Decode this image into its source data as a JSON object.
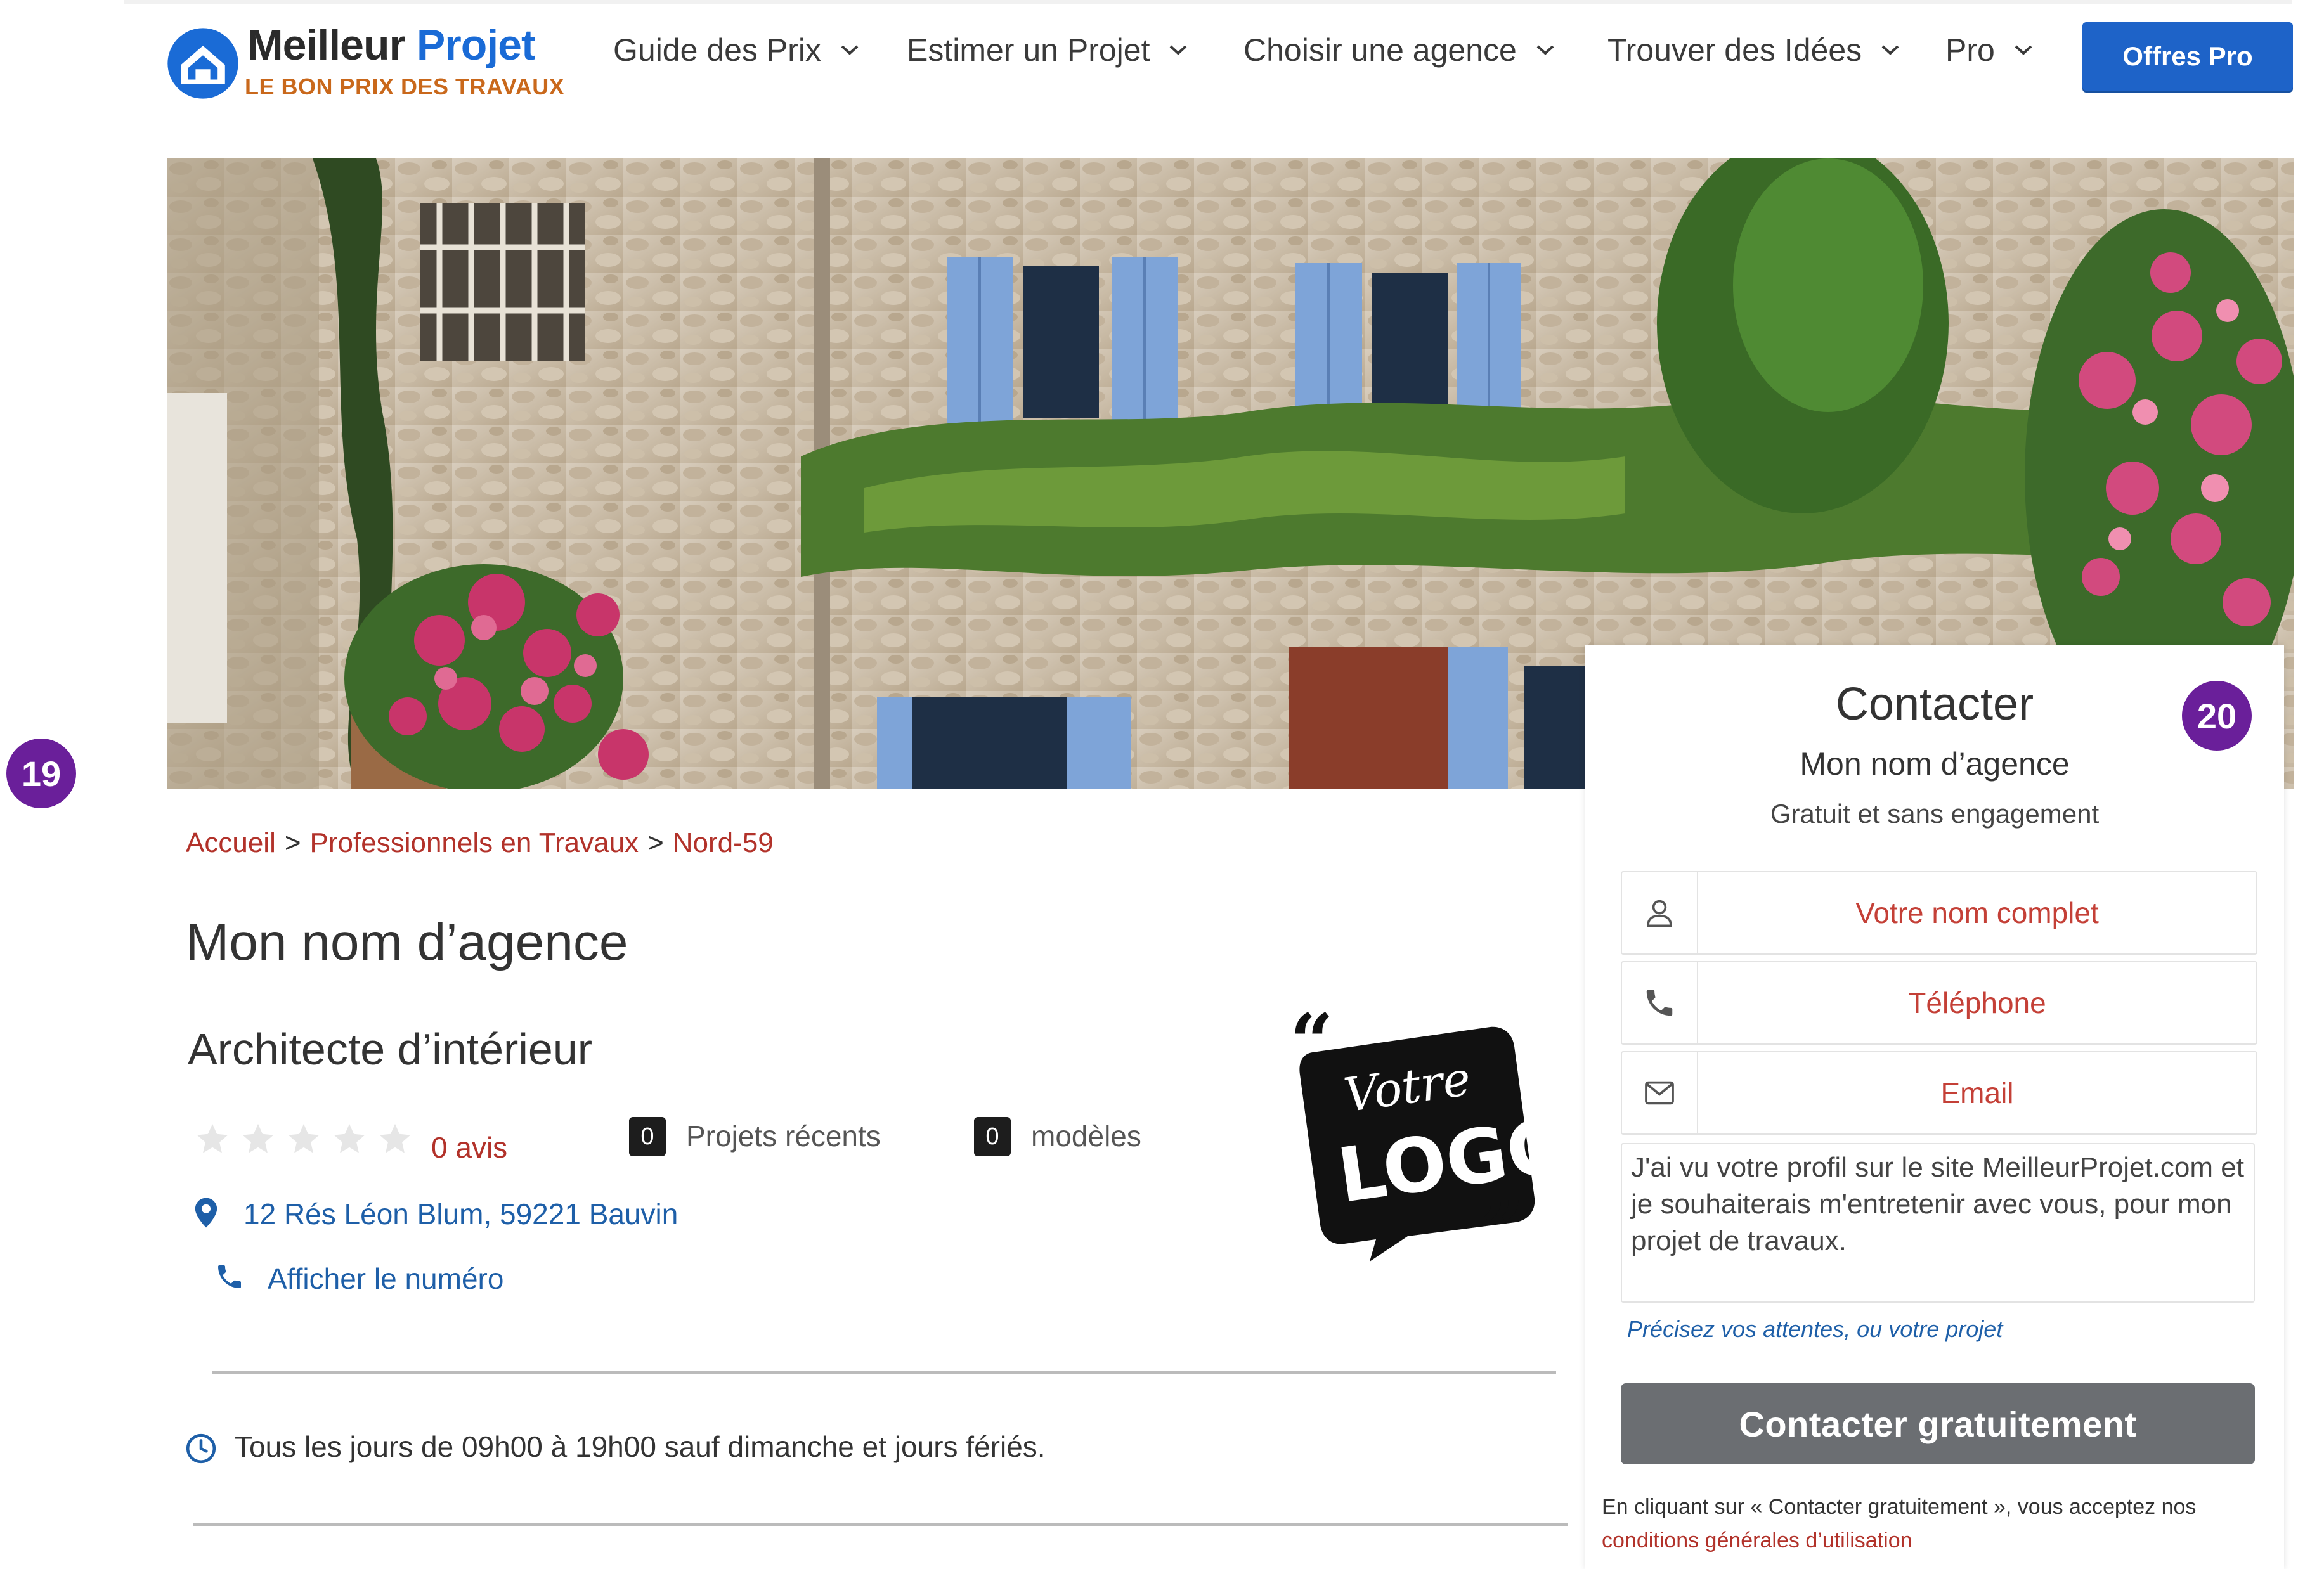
{
  "header": {
    "brand_main": "Meilleur",
    "brand_accent": "Projet",
    "brand_tagline": "LE BON PRIX DES TRAVAUX",
    "nav": [
      {
        "label": "Guide des Prix"
      },
      {
        "label": "Estimer un Projet"
      },
      {
        "label": "Choisir une agence"
      },
      {
        "label": "Trouver des Idées"
      },
      {
        "label": "Pro"
      }
    ],
    "cta": "Offres Pro"
  },
  "badges": {
    "left": "19",
    "right": "20"
  },
  "breadcrumb": [
    "Accueil",
    "Professionnels en Travaux",
    "Nord-59"
  ],
  "breadcrumb_sep": ">",
  "agency": {
    "name": "Mon nom d’agence",
    "category": "Architecte d’intérieur",
    "rating_stars": 0,
    "reviews": "0 avis",
    "projects_count": "0",
    "projects_label": "Projets récents",
    "models_count": "0",
    "models_label": "modèles",
    "address": "12 Rés Léon Blum, 59221 Bauvin",
    "show_number": "Afficher le numéro",
    "hours": "Tous les jours de 09h00 à 19h00 sauf dimanche et jours fériés."
  },
  "logo_placeholder": {
    "line1": "Votre",
    "line2": "LOGO"
  },
  "contact": {
    "title": "Contacter",
    "agency": "Mon nom d’agence",
    "subtitle": "Gratuit et sans engagement",
    "name_placeholder": "Votre nom complet",
    "phone_placeholder": "Téléphone",
    "email_placeholder": "Email",
    "message": "J'ai vu votre profil sur le site MeilleurProjet.com et je souhaiterais m'entretenir avec vous, pour mon projet de travaux.",
    "hint": "Précisez vos attentes, ou votre projet",
    "submit": "Contacter gratuitement",
    "legal": "En cliquant sur « Contacter gratuitement », vous acceptez nos",
    "legal_link": "conditions générales d’utilisation"
  },
  "colors": {
    "accent_blue": "#1e63c8",
    "link_red": "#b2322a",
    "link_blue": "#1e5fa8",
    "badge_purple": "#6a1f9a",
    "button_grey": "#6b6e72"
  },
  "icons": [
    "house-logo-icon",
    "chevron-down-icon",
    "star-icon",
    "map-pin-icon",
    "phone-icon",
    "clock-icon",
    "user-icon",
    "envelope-icon"
  ]
}
